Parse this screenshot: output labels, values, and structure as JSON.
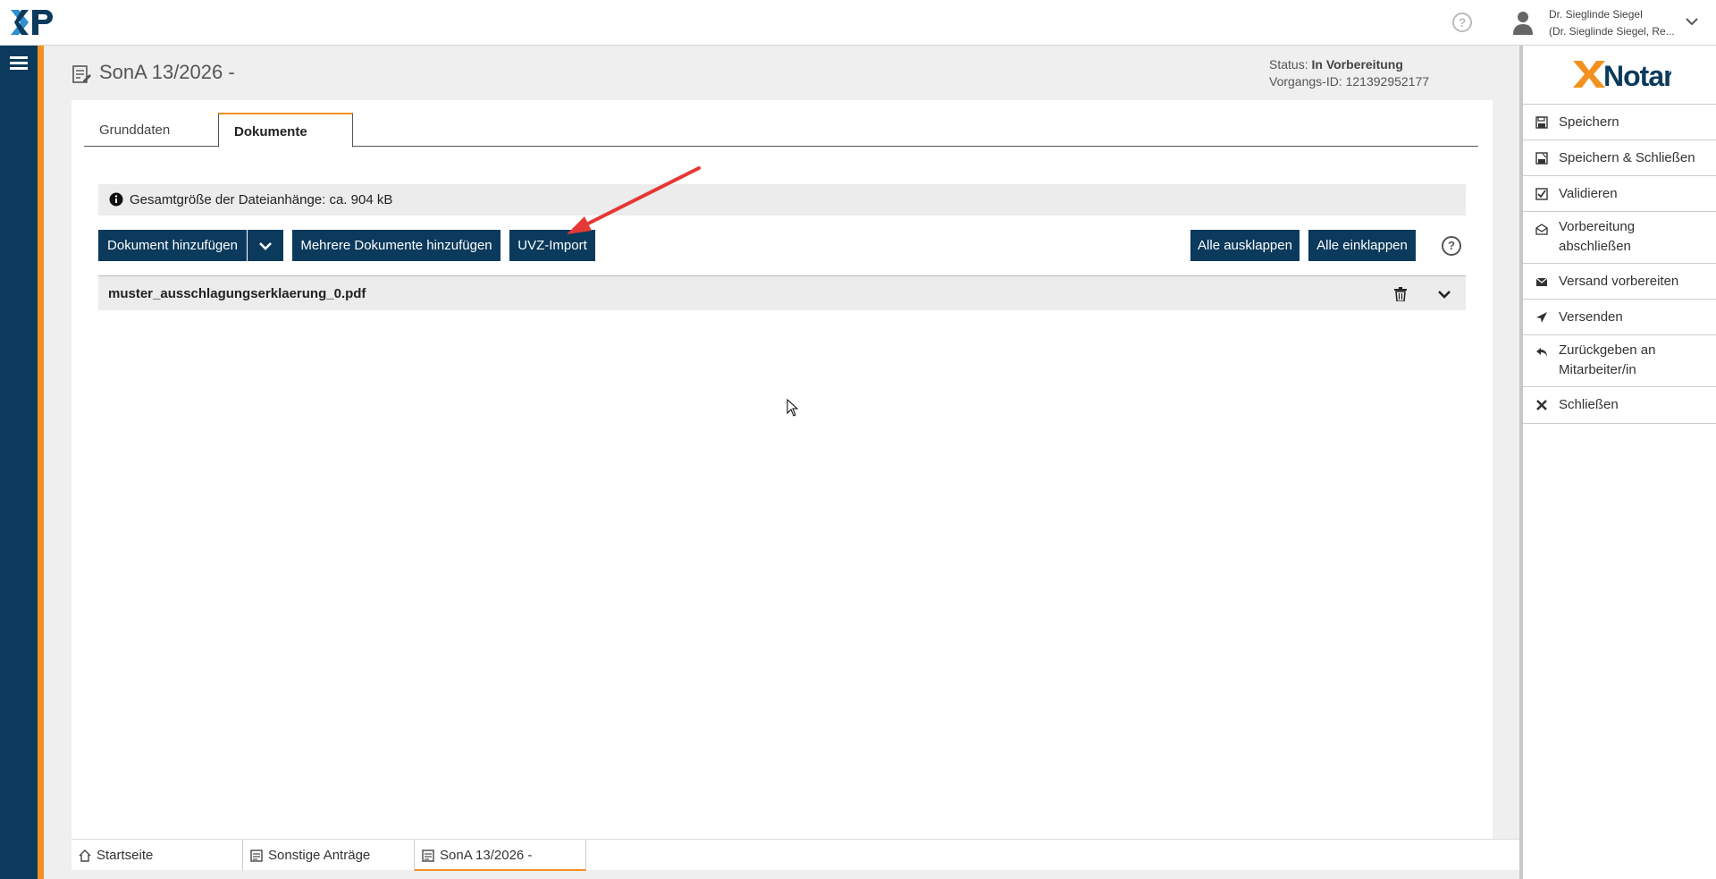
{
  "topbar": {
    "help_icon": "question-circle-icon",
    "user_name_line1": "Dr. Sieglinde Siegel",
    "user_name_line2": "(Dr. Sieglinde Siegel, Re..."
  },
  "page": {
    "title": "SonA 13/2026 -",
    "status_label": "Status:",
    "status_value": "In Vorbereitung",
    "vorgang_label": "Vorgangs-ID:",
    "vorgang_value": "121392952177"
  },
  "tabs": [
    {
      "label": "Grunddaten",
      "active": false
    },
    {
      "label": "Dokumente",
      "active": true
    }
  ],
  "info": {
    "text": "Gesamtgröße der Dateianhänge: ca. 904 kB"
  },
  "buttons": {
    "add_document": "Dokument hinzufügen",
    "add_multiple": "Mehrere Dokumente hinzufügen",
    "uvz_import": "UVZ-Import",
    "expand_all": "Alle ausklappen",
    "collapse_all": "Alle einklappen",
    "help": "?"
  },
  "documents": [
    {
      "name": "muster_ausschlagungserklaerung_0.pdf"
    }
  ],
  "bottom_tabs": [
    {
      "label": "Startseite",
      "icon": "home-icon"
    },
    {
      "label": "Sonstige Anträge",
      "icon": "document-list-icon"
    },
    {
      "label": "SonA 13/2026 -",
      "icon": "document-list-icon",
      "active": true
    }
  ],
  "sidebar": {
    "logo_text": "XNotar",
    "items": [
      {
        "label": "Speichern",
        "icon": "save-icon"
      },
      {
        "label": "Speichern & Schließen",
        "icon": "save-close-icon"
      },
      {
        "label": "Validieren",
        "icon": "checkbox-icon"
      },
      {
        "label": "Vorbereitung abschließen",
        "icon": "envelope-open-icon"
      },
      {
        "label": "Versand vorbereiten",
        "icon": "envelope-icon"
      },
      {
        "label": "Versenden",
        "icon": "paper-plane-icon"
      },
      {
        "label": "Zurückgeben an Mitarbeiter/in",
        "icon": "reply-icon"
      },
      {
        "label": "Schließen",
        "icon": "close-icon"
      }
    ]
  },
  "colors": {
    "navy": "#0b3a5c",
    "accent": "#f39120",
    "arrow": "#e53935"
  }
}
